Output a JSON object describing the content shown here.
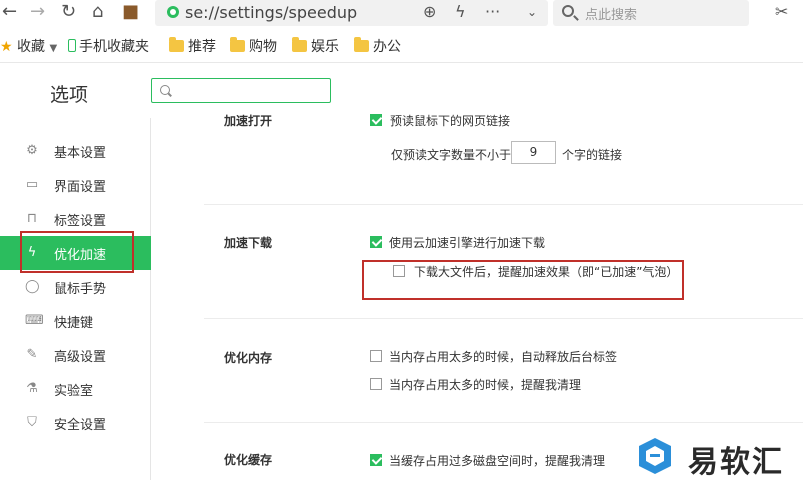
{
  "toolbar": {
    "url": "se://settings/speedup",
    "search_placeholder": "点此搜索"
  },
  "bookmarks": [
    {
      "label": "收藏",
      "kind": "star"
    },
    {
      "label": "手机收藏夹",
      "kind": "phone"
    },
    {
      "label": "推荐",
      "kind": "folder"
    },
    {
      "label": "购物",
      "kind": "folder"
    },
    {
      "label": "娱乐",
      "kind": "folder"
    },
    {
      "label": "办公",
      "kind": "folder"
    }
  ],
  "options": {
    "title": "选项",
    "search_value": ""
  },
  "sidebar": {
    "items": [
      {
        "label": "基本设置",
        "icon": "gear-icon"
      },
      {
        "label": "界面设置",
        "icon": "window-icon"
      },
      {
        "label": "标签设置",
        "icon": "tab-icon"
      },
      {
        "label": "优化加速",
        "icon": "lightning-icon",
        "active": true
      },
      {
        "label": "鼠标手势",
        "icon": "mouse-icon"
      },
      {
        "label": "快捷键",
        "icon": "keyboard-icon"
      },
      {
        "label": "高级设置",
        "icon": "wrench-icon"
      },
      {
        "label": "实验室",
        "icon": "flask-icon"
      },
      {
        "label": "安全设置",
        "icon": "shield-icon"
      }
    ]
  },
  "content": {
    "open_section": {
      "label": "加速打开",
      "preload_option": "预读鼠标下的网页链接",
      "min_chars_prefix": "仅预读文字数量不小于",
      "min_chars_value": "9",
      "min_chars_suffix": "个字的链接"
    },
    "download_section": {
      "label": "加速下载",
      "cloud_option": "使用云加速引擎进行加速下载",
      "cloud_checked": true,
      "bubble_option": "下载大文件后，提醒加速效果（即“已加速”气泡）",
      "bubble_checked": false
    },
    "memory_section": {
      "label": "优化内存",
      "release_option": "当内存占用太多的时候，自动释放后台标签",
      "release_checked": false,
      "remind_option": "当内存占用太多的时候，提醒我清理",
      "remind_checked": false
    },
    "cache_section": {
      "label": "优化缓存",
      "cache_option": "当缓存占用过多磁盘空间时，提醒我清理",
      "cache_checked": true
    }
  },
  "watermark": {
    "text": "易软汇"
  },
  "colors": {
    "accent": "#2bbd5e",
    "highlight": "#c0302a"
  }
}
